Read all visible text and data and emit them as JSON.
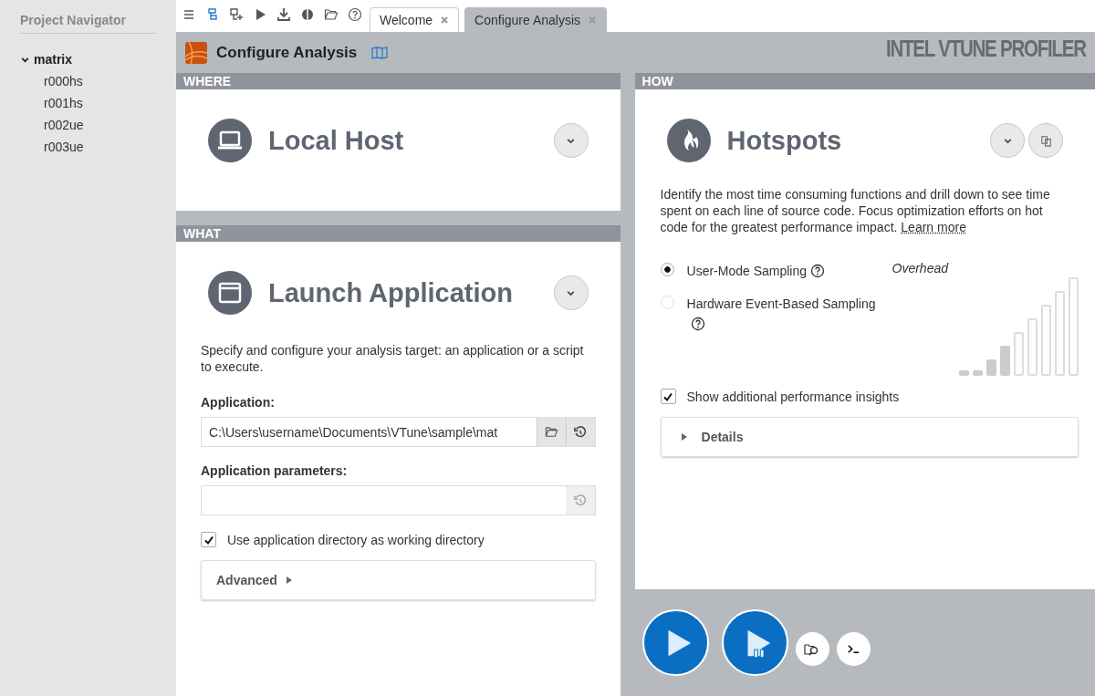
{
  "sidebar": {
    "title": "Project Navigator",
    "tree": [
      {
        "label": "matrix",
        "expanded": true,
        "children": [
          {
            "label": "r000hs"
          },
          {
            "label": "r001hs"
          },
          {
            "label": "r002ue"
          },
          {
            "label": "r003ue"
          }
        ]
      }
    ]
  },
  "tabs": [
    {
      "label": "Welcome",
      "selected": false
    },
    {
      "label": "Configure Analysis",
      "selected": true
    }
  ],
  "header": {
    "title": "Configure Analysis",
    "brand": "INTEL VTUNE PROFILER"
  },
  "where": {
    "heading": "WHERE",
    "title": "Local Host"
  },
  "what": {
    "heading": "WHAT",
    "title": "Launch Application",
    "description": "Specify and configure your analysis target: an application or a script to execute.",
    "application_label": "Application:",
    "application_value": "C:\\Users\\username\\Documents\\VTune\\sample\\mat",
    "parameters_label": "Application parameters:",
    "working_dir": {
      "label": "Use application directory as working directory",
      "checked": true
    },
    "advanced": "Advanced"
  },
  "how": {
    "heading": "HOW",
    "title": "Hotspots",
    "description": "Identify the most time consuming functions and drill down to see time spent on each line of source code. Focus optimization efforts on hot code for the greatest performance impact.",
    "link": "Learn more",
    "options": [
      {
        "label": "User-Mode Sampling",
        "selected": true
      },
      {
        "label": "Hardware Event-Based Sampling",
        "selected": false
      }
    ],
    "overhead": {
      "label": "Overhead",
      "level": 0.44
    },
    "insights": {
      "label": "Show additional performance insights",
      "checked": true
    },
    "details": "Details"
  }
}
